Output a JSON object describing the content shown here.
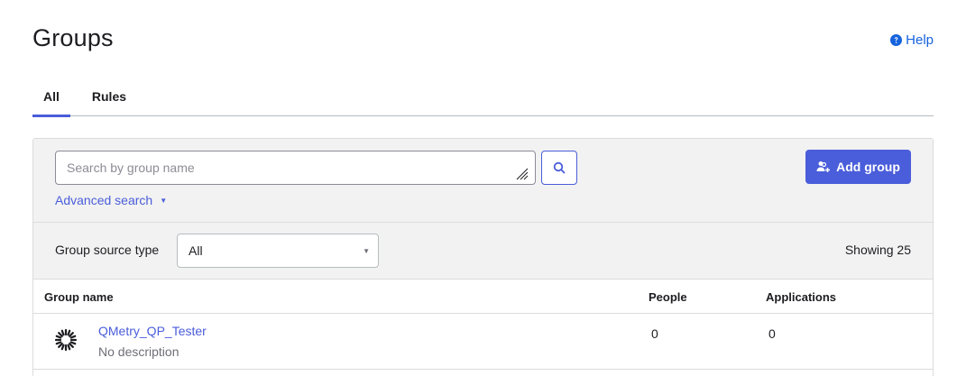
{
  "header": {
    "title": "Groups",
    "help_label": "Help",
    "help_icon": "question-circle-icon"
  },
  "tabs": [
    {
      "label": "All",
      "active": true
    },
    {
      "label": "Rules",
      "active": false
    }
  ],
  "search": {
    "placeholder": "Search by group name",
    "value": "",
    "search_icon": "search-icon",
    "advanced_label": "Advanced search",
    "advanced_icon": "caret-down-icon"
  },
  "add_group": {
    "label": "Add group",
    "icon": "add-group-icon"
  },
  "filter": {
    "label": "Group source type",
    "selected": "All",
    "showing": "Showing 25"
  },
  "table": {
    "columns": [
      "Group name",
      "People",
      "Applications"
    ],
    "rows": [
      {
        "logo": "qmetry-logo-icon",
        "name": "QMetry_QP_Tester",
        "description": "No description",
        "people": "0",
        "applications": "0"
      }
    ]
  },
  "colors": {
    "accent": "#4a5dda",
    "link": "#1662dd",
    "panel_bg": "#f2f2f2",
    "border": "#dcdcdc"
  }
}
